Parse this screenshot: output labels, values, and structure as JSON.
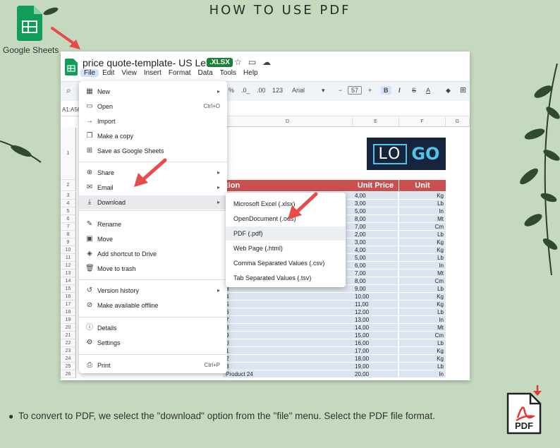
{
  "heading": "HOW TO USE PDF",
  "google_sheets_label": "Google Sheets",
  "window": {
    "doc_title": "price quote-template- US Letter",
    "badge": ".XLSX",
    "menubar": [
      "File",
      "Edit",
      "View",
      "Insert",
      "Format",
      "Data",
      "Tools",
      "Help"
    ],
    "toolbar": {
      "percent": "%",
      "dec_down": ".0_",
      "dec_up": ".00",
      "num_format": "123",
      "font": "Arial",
      "minus": "−",
      "font_size": "57",
      "plus": "+",
      "bold": "B",
      "italic": "I",
      "strike": "S",
      "text_color": "A"
    },
    "cell_ref": "A1:A56",
    "columns": [
      "D",
      "E",
      "F",
      "G"
    ],
    "header_row": {
      "description_fragment": "tion",
      "unit_price": "Unit Price",
      "unit": "Unit"
    },
    "rows": [
      {
        "n": "3",
        "desc": "",
        "price": "4,00",
        "unit": "Kg"
      },
      {
        "n": "4",
        "desc": "",
        "price": "3,00",
        "unit": "Lb"
      },
      {
        "n": "5",
        "desc": "",
        "price": "5,00",
        "unit": "In"
      },
      {
        "n": "6",
        "desc": "",
        "price": "8,00",
        "unit": "Mt"
      },
      {
        "n": "7",
        "desc": "",
        "price": "7,00",
        "unit": "Cm"
      },
      {
        "n": "8",
        "desc": "",
        "price": "2,00",
        "unit": "Lb"
      },
      {
        "n": "9",
        "desc": "",
        "price": "3,00",
        "unit": "Kg"
      },
      {
        "n": "10",
        "desc": "",
        "price": "4,00",
        "unit": "Kg"
      },
      {
        "n": "11",
        "desc": "",
        "price": "5,00",
        "unit": "Lb"
      },
      {
        "n": "12",
        "desc": "",
        "price": "6,00",
        "unit": "In"
      },
      {
        "n": "13",
        "desc": "",
        "price": "7,00",
        "unit": "Mt"
      },
      {
        "n": "14",
        "desc": "",
        "price": "8,00",
        "unit": "Cm"
      },
      {
        "n": "15",
        "desc": "3",
        "price": "9,00",
        "unit": "Lb"
      },
      {
        "n": "16",
        "desc": "4",
        "price": "10,00",
        "unit": "Kg"
      },
      {
        "n": "17",
        "desc": "5",
        "price": "11,00",
        "unit": "Kg"
      },
      {
        "n": "18",
        "desc": "6",
        "price": "12,00",
        "unit": "Lb"
      },
      {
        "n": "19",
        "desc": "7",
        "price": "13,00",
        "unit": "In"
      },
      {
        "n": "20",
        "desc": "8",
        "price": "14,00",
        "unit": "Mt"
      },
      {
        "n": "21",
        "desc": "9",
        "price": "15,00",
        "unit": "Cm"
      },
      {
        "n": "22",
        "desc": "0",
        "price": "16,00",
        "unit": "Lb"
      },
      {
        "n": "23",
        "desc": "1",
        "price": "17,00",
        "unit": "Kg"
      },
      {
        "n": "24",
        "desc": "2",
        "price": "18,00",
        "unit": "Kg"
      },
      {
        "n": "25",
        "desc": "3",
        "price": "19,00",
        "unit": "Lb"
      },
      {
        "n": "26",
        "desc": "Product 24",
        "price": "20,00",
        "unit": "In"
      }
    ],
    "row_labels": [
      "1",
      "2"
    ],
    "file_menu": [
      {
        "icon": "new-icon",
        "glyph": "▦",
        "label": "New",
        "shortcut": "",
        "arrow": "▸"
      },
      {
        "icon": "open-icon",
        "glyph": "▭",
        "label": "Open",
        "shortcut": "Ctrl+O",
        "arrow": ""
      },
      {
        "icon": "import-icon",
        "glyph": "→",
        "label": "Import",
        "shortcut": "",
        "arrow": ""
      },
      {
        "icon": "copy-icon",
        "glyph": "❐",
        "label": "Make a copy",
        "shortcut": "",
        "arrow": ""
      },
      {
        "icon": "save-sheets-icon",
        "glyph": "⊞",
        "label": "Save as Google Sheets",
        "shortcut": "",
        "arrow": ""
      },
      {
        "icon": "share-icon",
        "glyph": "⊕",
        "label": "Share",
        "shortcut": "",
        "arrow": "▸"
      },
      {
        "icon": "email-icon",
        "glyph": "✉",
        "label": "Email",
        "shortcut": "",
        "arrow": "▸"
      },
      {
        "icon": "download-icon",
        "glyph": "⤓",
        "label": "Download",
        "shortcut": "",
        "arrow": "▸"
      },
      {
        "icon": "rename-icon",
        "glyph": "✎",
        "label": "Rename",
        "shortcut": "",
        "arrow": ""
      },
      {
        "icon": "move-icon",
        "glyph": "▣",
        "label": "Move",
        "shortcut": "",
        "arrow": ""
      },
      {
        "icon": "shortcut-icon",
        "glyph": "◈",
        "label": "Add shortcut to Drive",
        "shortcut": "",
        "arrow": ""
      },
      {
        "icon": "trash-icon",
        "glyph": "🗑",
        "label": "Move to trash",
        "shortcut": "",
        "arrow": ""
      },
      {
        "icon": "history-icon",
        "glyph": "↺",
        "label": "Version history",
        "shortcut": "",
        "arrow": "▸"
      },
      {
        "icon": "offline-icon",
        "glyph": "⊘",
        "label": "Make available offline",
        "shortcut": "",
        "arrow": ""
      },
      {
        "icon": "details-icon",
        "glyph": "ⓘ",
        "label": "Details",
        "shortcut": "",
        "arrow": ""
      },
      {
        "icon": "settings-icon",
        "glyph": "⚙",
        "label": "Settings",
        "shortcut": "",
        "arrow": ""
      },
      {
        "icon": "print-icon",
        "glyph": "⎙",
        "label": "Print",
        "shortcut": "Ctrl+P",
        "arrow": ""
      }
    ],
    "download_menu": [
      "Microsoft Excel (.xlsx)",
      "OpenDocument (.ods)",
      "PDF (.pdf)",
      "Web Page (.html)",
      "Comma Separated Values (.csv)",
      "Tab Separated Values (.tsv)"
    ]
  },
  "instruction": "To convert to PDF, we select the \"download\" option from the \"file\" menu. Select the PDF file format.",
  "pdf_icon_label": "PDF",
  "colors": {
    "accent_red": "#e94b4b",
    "header_red": "#c9504e",
    "sheets_green": "#0f9d58"
  }
}
